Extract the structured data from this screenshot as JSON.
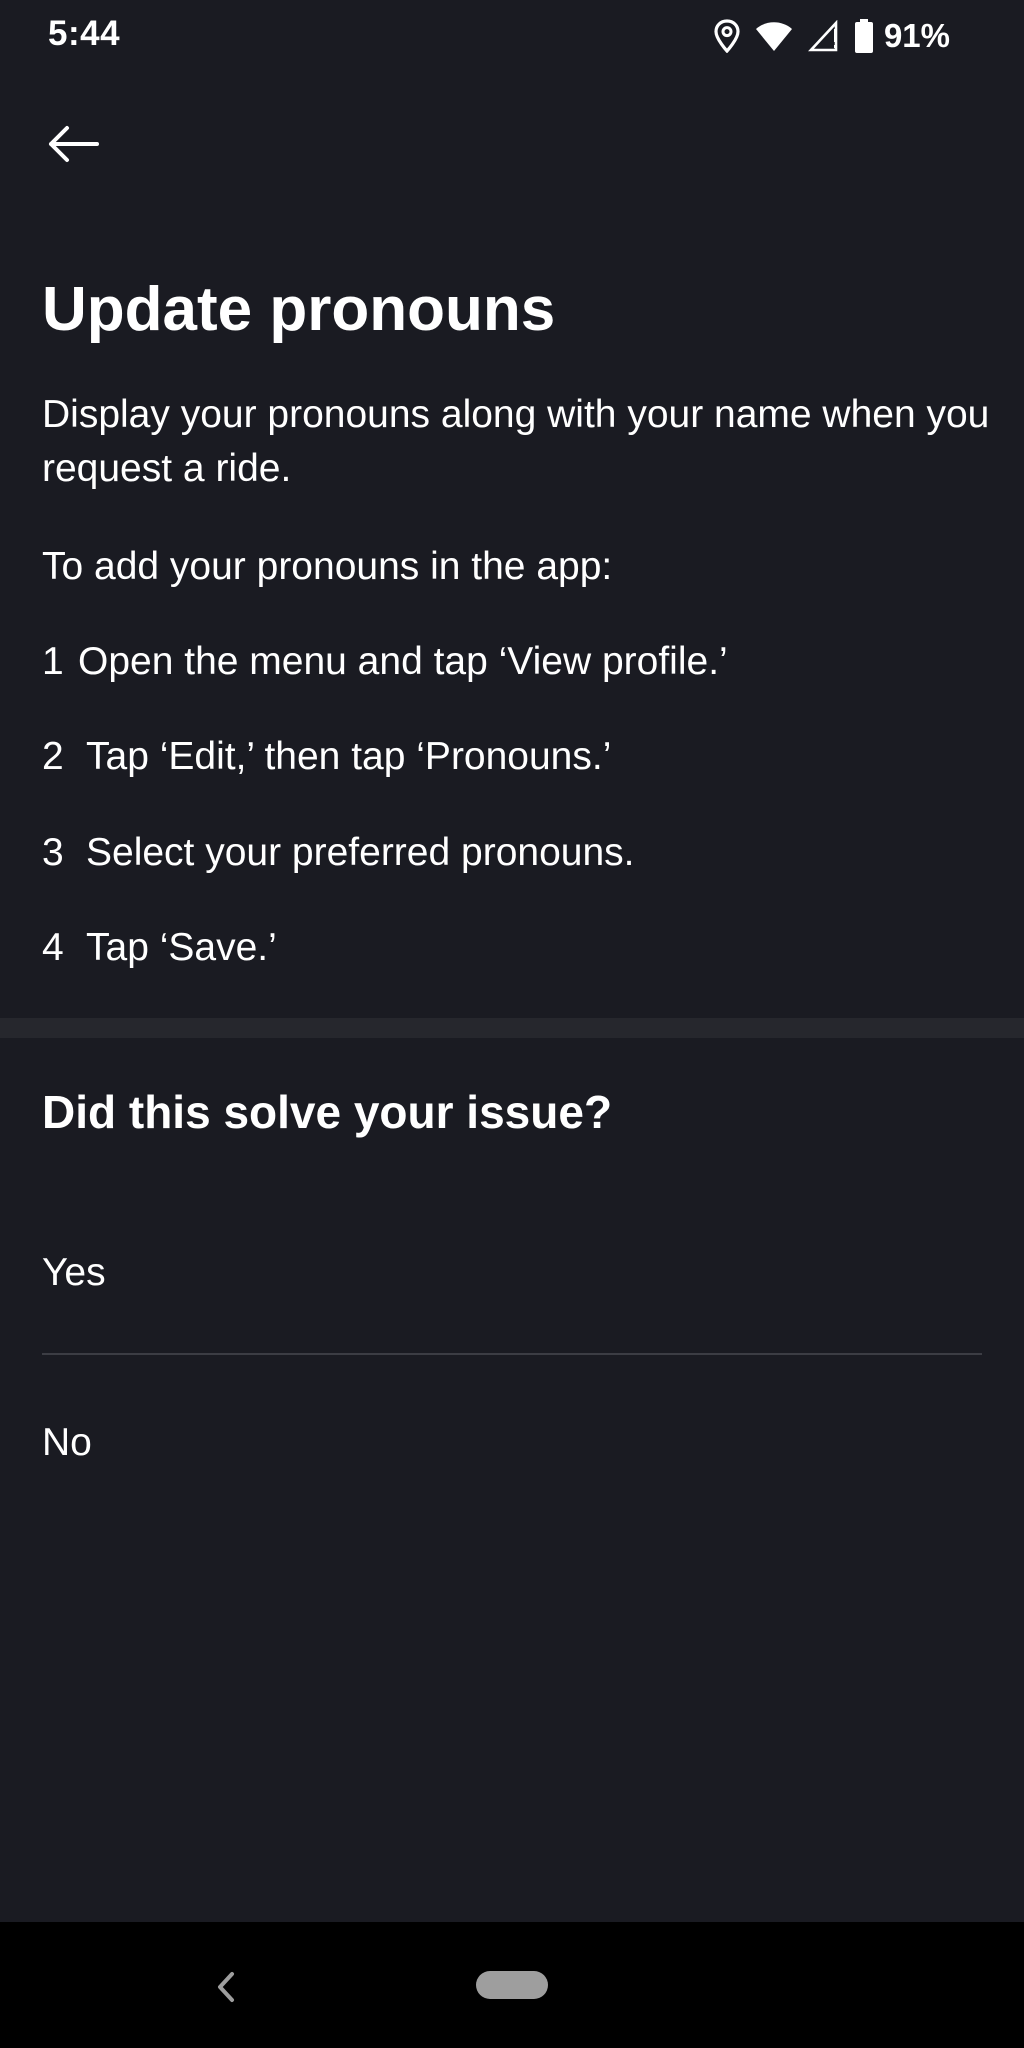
{
  "status_bar": {
    "time": "5:44",
    "battery_percent": "91%",
    "icons": [
      "location-icon",
      "wifi-icon",
      "cell-signal-icon",
      "battery-icon"
    ]
  },
  "header": {
    "back_icon": "back-arrow-icon"
  },
  "content": {
    "title": "Update pronouns",
    "intro": "Display your pronouns along with your name when you request a ride.",
    "instructions_header": "To add your pronouns in the app:",
    "steps": [
      {
        "number": "1",
        "text": "Open the menu and tap ‘View profile.’"
      },
      {
        "number": "2",
        "text": "Tap ‘Edit,’ then tap ‘Pronouns.’"
      },
      {
        "number": "3",
        "text": "Select your preferred pronouns."
      },
      {
        "number": "4",
        "text": "Tap ‘Save.’"
      }
    ]
  },
  "feedback": {
    "title": "Did this solve your issue?",
    "options": [
      {
        "label": "Yes"
      },
      {
        "label": "No"
      }
    ]
  },
  "nav_bar": {
    "icons": [
      "nav-back-icon",
      "home-pill-icon"
    ]
  },
  "colors": {
    "background": "#1a1b22",
    "divider": "#26272d",
    "separator": "#3c3d44",
    "text": "#ffffff",
    "nav_bar": "#000000"
  }
}
